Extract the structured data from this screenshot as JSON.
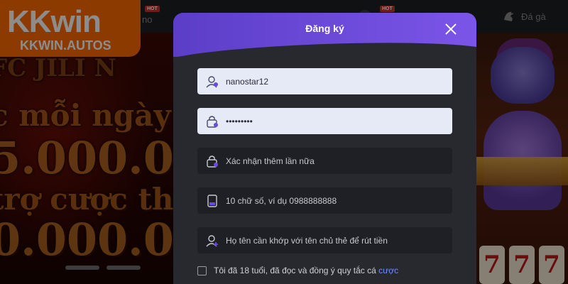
{
  "brand": {
    "logo_main": "KKwin",
    "logo_sub": "KKWIN.AUTOS",
    "color": "#ff6a00"
  },
  "nav": {
    "hot_badge": "HOT",
    "partial_label_left": "no",
    "last_item_label": "Đá gà"
  },
  "banner": {
    "lines": [
      "FC JILI N",
      "c mỗi ngày",
      "5.000.0",
      "trợ cược th",
      "0.000.0"
    ]
  },
  "slots": [
    "7",
    "7",
    "7"
  ],
  "modal": {
    "title": "Đăng ký",
    "accent": "#6a4ae0",
    "username": {
      "value": "nanostar12",
      "icon": "user-icon"
    },
    "password": {
      "value": "•••••••••",
      "icon": "lock-icon"
    },
    "confirm_password": {
      "placeholder": "Xác nhận thêm lần nữa",
      "icon": "lock-icon"
    },
    "phone": {
      "placeholder": "10 chữ số, ví dụ 0988888888",
      "icon": "phone-icon"
    },
    "fullname": {
      "placeholder": "Họ tên cần khớp với tên chủ thẻ để rút tiền",
      "icon": "user-add-icon"
    },
    "terms": {
      "text": "Tôi đã 18 tuổi, đã đọc và đồng ý quy tắc cá",
      "link": "cược"
    }
  }
}
